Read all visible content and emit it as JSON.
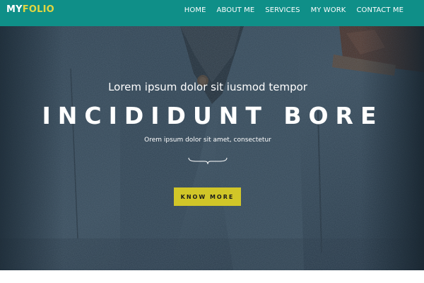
{
  "brand": {
    "part1": "MY",
    "part2": "FOLIO"
  },
  "nav": {
    "items": [
      {
        "label": "HOME"
      },
      {
        "label": "ABOUT ME"
      },
      {
        "label": "SERVICES"
      },
      {
        "label": "MY WORK"
      },
      {
        "label": "CONTACT ME"
      }
    ]
  },
  "hero": {
    "subtitle": "Lorem ipsum dolor sit iusmod tempor",
    "title": "INCIDIDUNT BORE",
    "tagline": "Orem ipsum dolor sit amet, consectetur",
    "button_label": "KNOW MORE",
    "divider_icon": "curly-brace-divider-icon"
  },
  "colors": {
    "navbar": "#0f8f88",
    "brand_accent": "#e2d640",
    "button": "#d1c628",
    "hero_bg": "#334755"
  }
}
